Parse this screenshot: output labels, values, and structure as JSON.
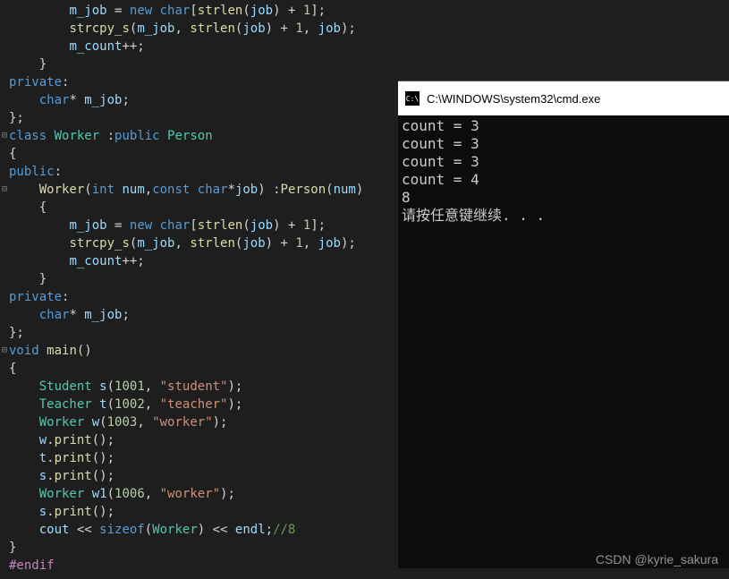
{
  "editor": {
    "lines": [
      {
        "indent": 2,
        "tokens": [
          [
            "id",
            "m_job"
          ],
          [
            "op",
            " = "
          ],
          [
            "kw",
            "new"
          ],
          [
            "op",
            " "
          ],
          [
            "kw",
            "char"
          ],
          [
            "op",
            "["
          ],
          [
            "fn",
            "strlen"
          ],
          [
            "op",
            "("
          ],
          [
            "id",
            "job"
          ],
          [
            "op",
            ") + "
          ],
          [
            "num",
            "1"
          ],
          [
            "op",
            "];"
          ]
        ]
      },
      {
        "indent": 2,
        "tokens": [
          [
            "fn",
            "strcpy_s"
          ],
          [
            "op",
            "("
          ],
          [
            "id",
            "m_job"
          ],
          [
            "op",
            ", "
          ],
          [
            "fn",
            "strlen"
          ],
          [
            "op",
            "("
          ],
          [
            "id",
            "job"
          ],
          [
            "op",
            ") + "
          ],
          [
            "num",
            "1"
          ],
          [
            "op",
            ", "
          ],
          [
            "id",
            "job"
          ],
          [
            "op",
            ");"
          ]
        ]
      },
      {
        "indent": 2,
        "tokens": [
          [
            "id",
            "m_count"
          ],
          [
            "op",
            "++;"
          ]
        ]
      },
      {
        "indent": 1,
        "tokens": [
          [
            "op",
            "}"
          ]
        ]
      },
      {
        "indent": 0,
        "tokens": [
          [
            "kw",
            "private"
          ],
          [
            "op",
            ":"
          ]
        ]
      },
      {
        "indent": 1,
        "tokens": [
          [
            "kw",
            "char"
          ],
          [
            "op",
            "* "
          ],
          [
            "id",
            "m_job"
          ],
          [
            "op",
            ";"
          ]
        ]
      },
      {
        "indent": 0,
        "tokens": [
          [
            "op",
            "};"
          ]
        ]
      },
      {
        "indent": 0,
        "fold": "⊟",
        "tokens": [
          [
            "kw",
            "class"
          ],
          [
            "op",
            " "
          ],
          [
            "type",
            "Worker"
          ],
          [
            "op",
            " :"
          ],
          [
            "kw",
            "public"
          ],
          [
            "op",
            " "
          ],
          [
            "type",
            "Person"
          ]
        ]
      },
      {
        "indent": 0,
        "tokens": [
          [
            "op",
            "{"
          ]
        ]
      },
      {
        "indent": 0,
        "tokens": [
          [
            "kw",
            "public"
          ],
          [
            "op",
            ":"
          ]
        ]
      },
      {
        "indent": 1,
        "fold": "⊟",
        "tokens": [
          [
            "fn",
            "Worker"
          ],
          [
            "op",
            "("
          ],
          [
            "kw",
            "int"
          ],
          [
            "op",
            " "
          ],
          [
            "id",
            "num"
          ],
          [
            "op",
            ","
          ],
          [
            "kw",
            "const"
          ],
          [
            "op",
            " "
          ],
          [
            "kw",
            "char"
          ],
          [
            "op",
            "*"
          ],
          [
            "id",
            "job"
          ],
          [
            "op",
            ") :"
          ],
          [
            "fn",
            "Person"
          ],
          [
            "op",
            "("
          ],
          [
            "id",
            "num"
          ],
          [
            "op",
            ")"
          ]
        ]
      },
      {
        "indent": 1,
        "tokens": [
          [
            "op",
            "{"
          ]
        ]
      },
      {
        "indent": 2,
        "tokens": [
          [
            "id",
            "m_job"
          ],
          [
            "op",
            " = "
          ],
          [
            "kw",
            "new"
          ],
          [
            "op",
            " "
          ],
          [
            "kw",
            "char"
          ],
          [
            "op",
            "["
          ],
          [
            "fn",
            "strlen"
          ],
          [
            "op",
            "("
          ],
          [
            "id",
            "job"
          ],
          [
            "op",
            ") + "
          ],
          [
            "num",
            "1"
          ],
          [
            "op",
            "];"
          ]
        ]
      },
      {
        "indent": 2,
        "tokens": [
          [
            "fn",
            "strcpy_s"
          ],
          [
            "op",
            "("
          ],
          [
            "id",
            "m_job"
          ],
          [
            "op",
            ", "
          ],
          [
            "fn",
            "strlen"
          ],
          [
            "op",
            "("
          ],
          [
            "id",
            "job"
          ],
          [
            "op",
            ") + "
          ],
          [
            "num",
            "1"
          ],
          [
            "op",
            ", "
          ],
          [
            "id",
            "job"
          ],
          [
            "op",
            ");"
          ]
        ]
      },
      {
        "indent": 2,
        "tokens": [
          [
            "id",
            "m_count"
          ],
          [
            "op",
            "++;"
          ]
        ]
      },
      {
        "indent": 1,
        "tokens": [
          [
            "op",
            "}"
          ]
        ]
      },
      {
        "indent": 0,
        "tokens": [
          [
            "kw",
            "private"
          ],
          [
            "op",
            ":"
          ]
        ]
      },
      {
        "indent": 1,
        "tokens": [
          [
            "kw",
            "char"
          ],
          [
            "op",
            "* "
          ],
          [
            "id",
            "m_job"
          ],
          [
            "op",
            ";"
          ]
        ]
      },
      {
        "indent": 0,
        "tokens": [
          [
            "op",
            "};"
          ]
        ]
      },
      {
        "indent": 0,
        "fold": "⊟",
        "tokens": [
          [
            "kw",
            "void"
          ],
          [
            "op",
            " "
          ],
          [
            "fn",
            "main"
          ],
          [
            "op",
            "()"
          ]
        ]
      },
      {
        "indent": 0,
        "tokens": [
          [
            "op",
            "{"
          ]
        ]
      },
      {
        "indent": 1,
        "tokens": [
          [
            "type",
            "Student"
          ],
          [
            "op",
            " "
          ],
          [
            "id",
            "s"
          ],
          [
            "op",
            "("
          ],
          [
            "num",
            "1001"
          ],
          [
            "op",
            ", "
          ],
          [
            "str",
            "\"student\""
          ],
          [
            "op",
            ");"
          ]
        ]
      },
      {
        "indent": 1,
        "tokens": [
          [
            "type",
            "Teacher"
          ],
          [
            "op",
            " "
          ],
          [
            "id",
            "t"
          ],
          [
            "op",
            "("
          ],
          [
            "num",
            "1002"
          ],
          [
            "op",
            ", "
          ],
          [
            "str",
            "\"teacher\""
          ],
          [
            "op",
            ");"
          ]
        ]
      },
      {
        "indent": 1,
        "tokens": [
          [
            "type",
            "Worker"
          ],
          [
            "op",
            " "
          ],
          [
            "id",
            "w"
          ],
          [
            "op",
            "("
          ],
          [
            "num",
            "1003"
          ],
          [
            "op",
            ", "
          ],
          [
            "str",
            "\"worker\""
          ],
          [
            "op",
            ");"
          ]
        ]
      },
      {
        "indent": 1,
        "tokens": [
          [
            "id",
            "w"
          ],
          [
            "op",
            "."
          ],
          [
            "fn",
            "print"
          ],
          [
            "op",
            "();"
          ]
        ]
      },
      {
        "indent": 1,
        "tokens": [
          [
            "id",
            "t"
          ],
          [
            "op",
            "."
          ],
          [
            "fn",
            "print"
          ],
          [
            "op",
            "();"
          ]
        ]
      },
      {
        "indent": 1,
        "tokens": [
          [
            "id",
            "s"
          ],
          [
            "op",
            "."
          ],
          [
            "fn",
            "print"
          ],
          [
            "op",
            "();"
          ]
        ]
      },
      {
        "indent": 1,
        "tokens": [
          [
            "type",
            "Worker"
          ],
          [
            "op",
            " "
          ],
          [
            "id",
            "w1"
          ],
          [
            "op",
            "("
          ],
          [
            "num",
            "1006"
          ],
          [
            "op",
            ", "
          ],
          [
            "str",
            "\"worker\""
          ],
          [
            "op",
            ");"
          ]
        ]
      },
      {
        "indent": 1,
        "tokens": [
          [
            "id",
            "s"
          ],
          [
            "op",
            "."
          ],
          [
            "fn",
            "print"
          ],
          [
            "op",
            "();"
          ]
        ]
      },
      {
        "indent": 1,
        "tokens": [
          [
            "id",
            "cout"
          ],
          [
            "op",
            " << "
          ],
          [
            "kw",
            "sizeof"
          ],
          [
            "op",
            "("
          ],
          [
            "type",
            "Worker"
          ],
          [
            "op",
            ") << "
          ],
          [
            "id",
            "endl"
          ],
          [
            "op",
            ";"
          ],
          [
            "cmt",
            "//8"
          ]
        ]
      },
      {
        "indent": 0,
        "tokens": [
          [
            "op",
            "}"
          ]
        ]
      },
      {
        "indent": 0,
        "tokens": [
          [
            "kw2",
            "#endif"
          ]
        ]
      }
    ]
  },
  "terminal": {
    "title": "C:\\WINDOWS\\system32\\cmd.exe",
    "icon_text": "C:\\",
    "output": [
      "count = 3",
      "count = 3",
      "count = 3",
      "count = 4",
      "8",
      "请按任意键继续. . ."
    ]
  },
  "watermark": "CSDN @kyrie_sakura"
}
